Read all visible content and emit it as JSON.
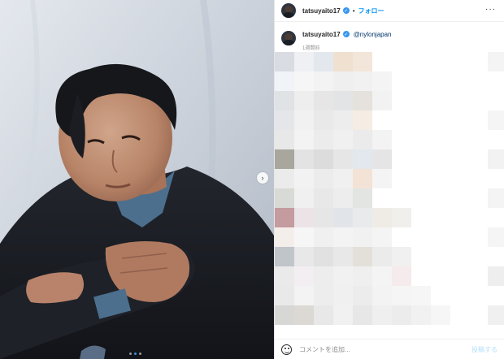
{
  "header": {
    "username": "tatsuyaito17",
    "separator": "•",
    "follow_label": "フォロー",
    "more_icon": "more-horizontal-icon"
  },
  "caption": {
    "username": "tatsuyaito17",
    "mention": "@nylonjapan",
    "time_ago": "1週間前"
  },
  "carousel": {
    "next_icon": "chevron-right-icon",
    "slide_count": 3,
    "active_slide": 2
  },
  "comment": {
    "placeholder": "コメントを追加...",
    "post_label": "投稿する",
    "emoji_icon": "smiley-icon"
  },
  "colors": {
    "accent": "#0095f6",
    "verified": "#3897f0",
    "post_disabled": "#b2dffc",
    "mention": "#00376b"
  }
}
